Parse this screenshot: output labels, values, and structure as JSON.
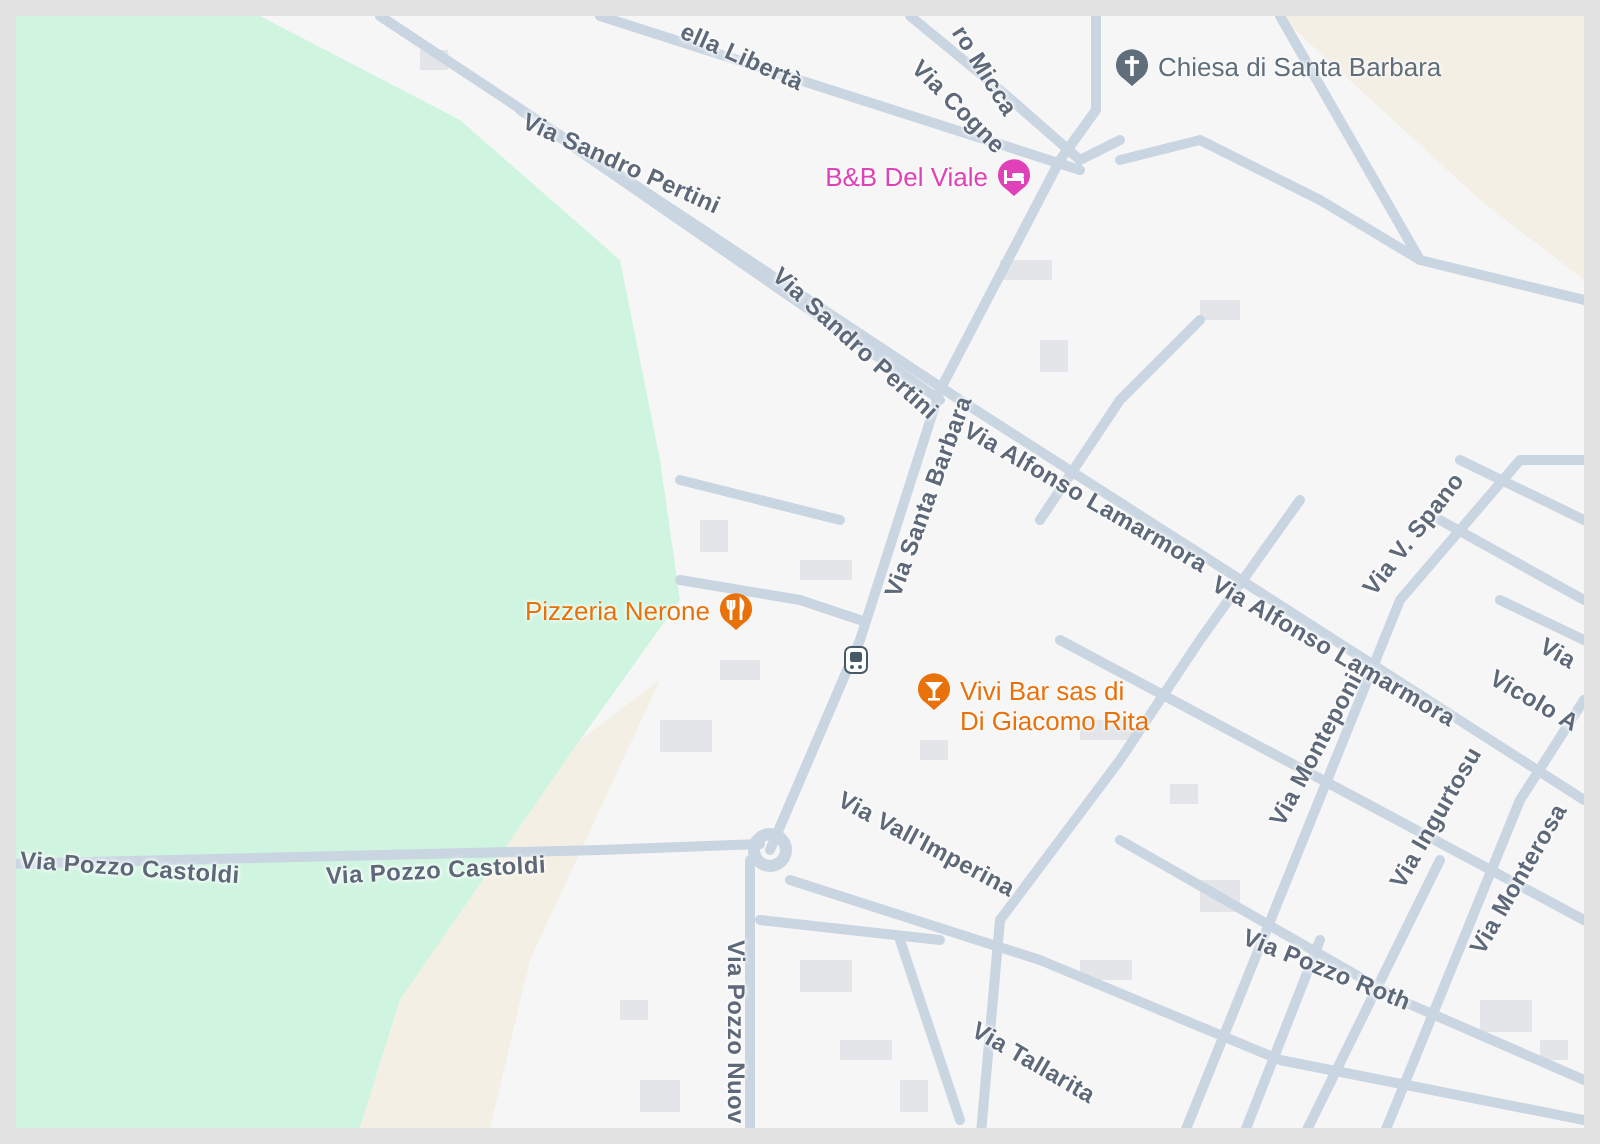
{
  "streets": [
    {
      "name": "ella Libertà"
    },
    {
      "name": "ro Micca"
    },
    {
      "name": "Via Cogne"
    },
    {
      "name": "Via Sandro Pertini"
    },
    {
      "name": "Via Sandro Pertini"
    },
    {
      "name": "Via Santa Barbara"
    },
    {
      "name": "Via Alfonso Lamarmora"
    },
    {
      "name": "Via Alfonso Lamarmora"
    },
    {
      "name": "Via V. Spano"
    },
    {
      "name": "Via"
    },
    {
      "name": "Vicolo A"
    },
    {
      "name": "Via Monteponi"
    },
    {
      "name": "Via Ingurtosu"
    },
    {
      "name": "Via Monterosa"
    },
    {
      "name": "Via Pozzo Roth"
    },
    {
      "name": "Via Vall'Imperina"
    },
    {
      "name": "Via Pozzo Castoldi"
    },
    {
      "name": "Via Pozzo Castoldi"
    },
    {
      "name": "Via Pozzo Nuov"
    },
    {
      "name": "Via Tallarita"
    }
  ],
  "places": [
    {
      "name": "Chiesa di Santa Barbara",
      "kind": "church",
      "color": "#5f6e7a"
    },
    {
      "name": "B&B Del Viale",
      "kind": "hotel",
      "color": "#e040b8"
    },
    {
      "name": "Pizzeria Nerone",
      "kind": "restaurant",
      "color": "#e8710a"
    },
    {
      "name": "Vivi Bar sas di Di Giacomo Rita",
      "kind": "bar",
      "color": "#e8710a"
    }
  ]
}
